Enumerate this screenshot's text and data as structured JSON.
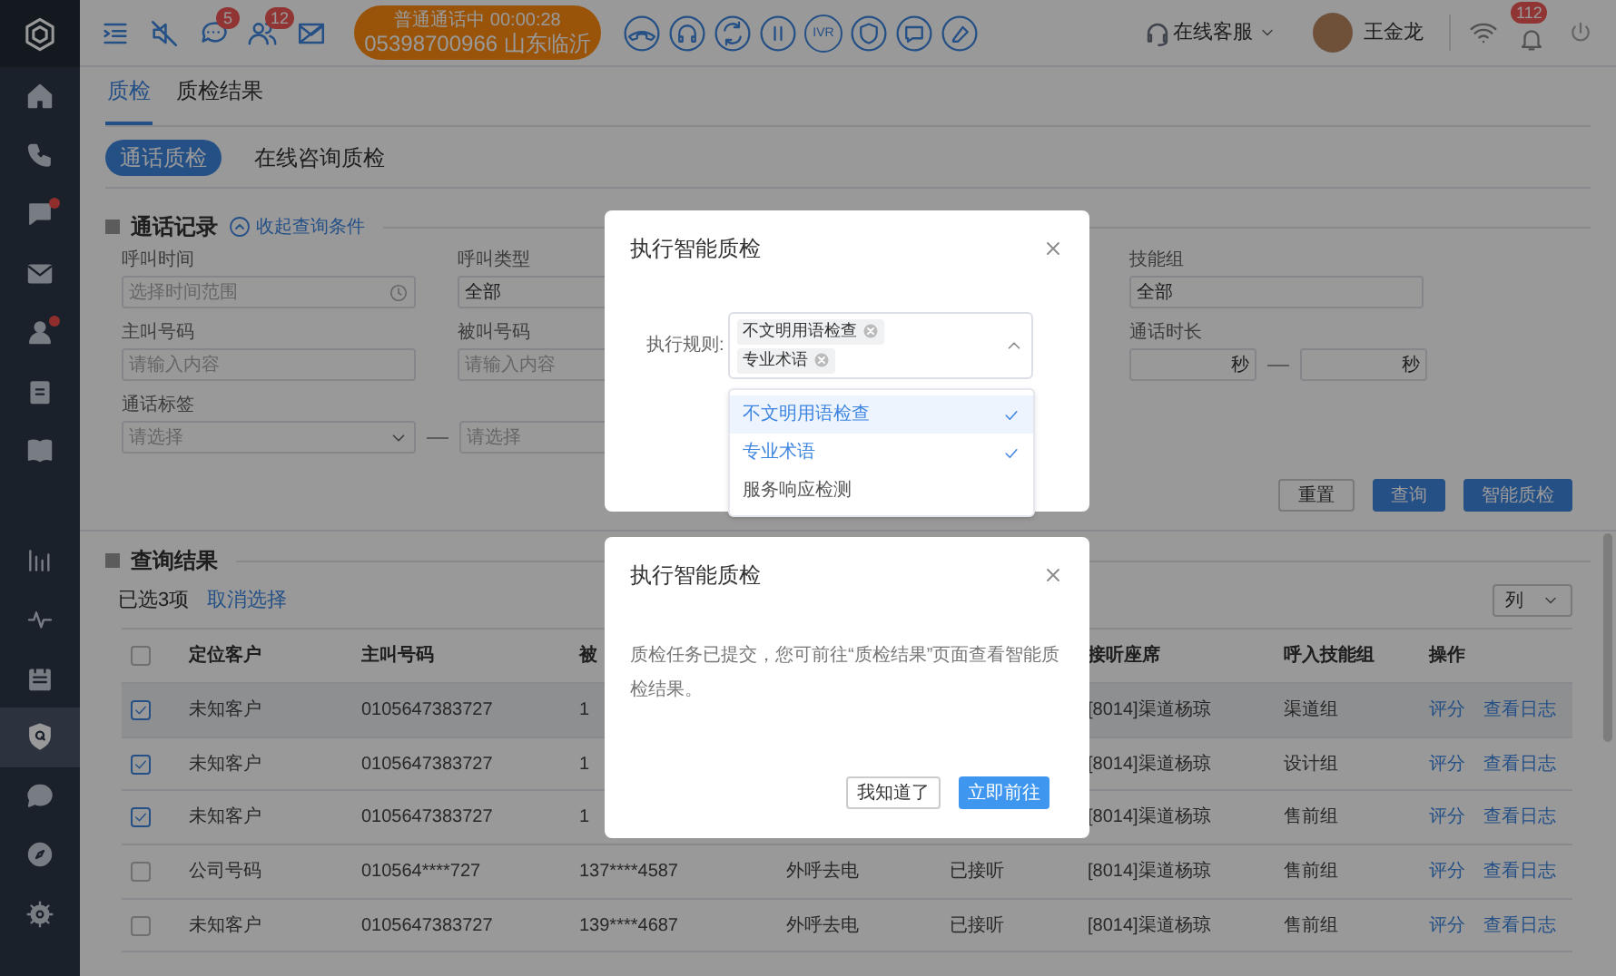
{
  "top_bar": {
    "message_badge": "5",
    "contact_badge": "12",
    "call": {
      "status": "普通通话中",
      "timer": "00:00:28",
      "number": "05398700966 山东临沂"
    },
    "ivr_label": "IVR",
    "agent_status": "在线客服",
    "user_name": "王金龙",
    "notification_badge": "112"
  },
  "sidebar": {
    "items": [
      {
        "selected": false,
        "dot": false
      },
      {
        "selected": false,
        "dot": false
      },
      {
        "selected": false,
        "dot": true
      },
      {
        "selected": false,
        "dot": false
      },
      {
        "selected": false,
        "dot": true
      },
      {
        "selected": false,
        "dot": false
      },
      {
        "selected": false,
        "dot": false
      },
      {
        "selected": false,
        "dot": false
      },
      {
        "selected": false,
        "dot": false
      },
      {
        "selected": false,
        "dot": false
      },
      {
        "selected": true,
        "dot": false
      },
      {
        "selected": false,
        "dot": false
      },
      {
        "selected": false,
        "dot": false
      },
      {
        "selected": false,
        "dot": false
      }
    ]
  },
  "tabs": [
    {
      "label": "质检",
      "selected": true
    },
    {
      "label": "质检结果",
      "selected": false
    }
  ],
  "sub_tabs": [
    {
      "label": "通话质检",
      "selected": true
    },
    {
      "label": "在线咨询质检",
      "selected": false
    }
  ],
  "filter": {
    "title": "通话记录",
    "toggle": "收起查询条件",
    "rows": [
      [
        {
          "kind": "date",
          "label": "呼叫时间",
          "placeholder": "选择时间范围"
        },
        {
          "kind": "select",
          "label": "呼叫类型",
          "value": "全部"
        },
        {
          "kind": "select",
          "label": "技能组",
          "value": "全部"
        }
      ],
      [
        {
          "kind": "text",
          "label": "主叫号码",
          "placeholder": "请输入内容"
        },
        {
          "kind": "text",
          "label": "被叫号码",
          "placeholder": "请输入内容"
        },
        {
          "kind": "range",
          "label": "通话时长",
          "unit": "秒",
          "unit_to": "秒"
        }
      ],
      [
        {
          "kind": "tags",
          "label": "通话标签",
          "placeholder": "请选择",
          "placeholder_to": "请选择"
        }
      ]
    ],
    "buttons": [
      {
        "label": "重置",
        "kind": "plain"
      },
      {
        "label": "查询",
        "kind": "primary"
      },
      {
        "label": "智能质检",
        "kind": "primary"
      }
    ]
  },
  "results": {
    "title": "查询结果",
    "selected_count": "已选3项",
    "clear": "取消选择",
    "columns_button": "列",
    "table": {
      "header_checked": false,
      "columns": [
        {
          "label": "定位客户"
        },
        {
          "label": "主叫号码"
        },
        {
          "label": "被"
        },
        {},
        {},
        {
          "label": "接听座席"
        },
        {
          "label": "呼入技能组"
        },
        {
          "label": "操作"
        }
      ],
      "rows": [
        {
          "checked": true,
          "hovered": true,
          "cells": [
            "未知客户",
            "0105647383727",
            "1",
            null,
            null,
            "[8014]渠道杨琼",
            "渠道组"
          ],
          "actions": [
            "评分",
            "查看日志"
          ]
        },
        {
          "checked": true,
          "hovered": false,
          "cells": [
            "未知客户",
            "0105647383727",
            "1",
            null,
            null,
            "[8014]渠道杨琼",
            "设计组"
          ],
          "actions": [
            "评分",
            "查看日志"
          ]
        },
        {
          "checked": true,
          "hovered": false,
          "cells": [
            "未知客户",
            "0105647383727",
            "1",
            null,
            null,
            "[8014]渠道杨琼",
            "售前组"
          ],
          "actions": [
            "评分",
            "查看日志"
          ]
        },
        {
          "checked": false,
          "hovered": false,
          "cells": [
            "公司号码",
            "010564****727",
            "137****4587",
            "外呼去电",
            "已接听",
            "[8014]渠道杨琼",
            "售前组"
          ],
          "actions": [
            "评分",
            "查看日志"
          ]
        },
        {
          "checked": false,
          "hovered": false,
          "cells": [
            "未知客户",
            "0105647383727",
            "139****4687",
            "外呼去电",
            "已接听",
            "[8014]渠道杨琼",
            "售前组"
          ],
          "actions": [
            "评分",
            "查看日志"
          ]
        }
      ]
    }
  },
  "rule_dialog": {
    "title": "执行智能质检",
    "rule_label": "执行规则:",
    "tags": [
      "不文明用语检查",
      "专业术语"
    ],
    "options": [
      {
        "label": "不文明用语检查",
        "selected": true,
        "hovered": true
      },
      {
        "label": "专业术语",
        "selected": true,
        "hovered": false
      },
      {
        "label": "服务响应检测",
        "selected": false,
        "hovered": false
      }
    ]
  },
  "notice_dialog": {
    "title": "执行智能质检",
    "message": "质检任务已提交，您可前往“质检结果”页面查看智能质检结果。",
    "buttons": [
      {
        "label": "我知道了",
        "kind": "plain"
      },
      {
        "label": "立即前往",
        "kind": "primary"
      }
    ]
  }
}
